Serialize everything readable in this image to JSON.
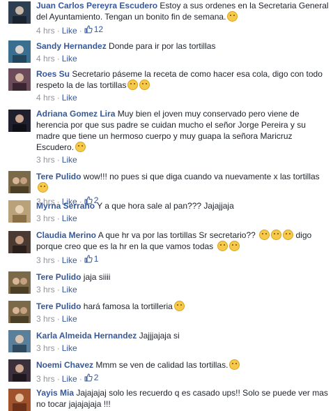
{
  "comments": [
    {
      "author": "Juan Carlos Pereyra Escudero",
      "text": " Estoy a sus ordenes en la Secretaria General del Ayuntamiento. Tengan un bonito fin de semana.",
      "time": "4 hrs",
      "like_label": "Like",
      "likes": "12",
      "emoji": [
        "smile-emoji"
      ],
      "avatar_color": "#2f3f52"
    },
    {
      "author": "Sandy Hernandez",
      "text": " Donde para ir por las tortillas",
      "time": "4 hrs",
      "like_label": "Like",
      "likes": "",
      "emoji": [],
      "avatar_color": "#3b6f8f"
    },
    {
      "author": "Roes Su",
      "text": " Secretario páseme la receta de como hacer esa cola, digo con todo respeto la de las tortillas",
      "time": "4 hrs",
      "like_label": "Like",
      "likes": "",
      "emoji": [
        "laugh-emoji",
        "laugh-emoji"
      ],
      "avatar_color": "#6b4a5a"
    },
    {
      "author": "Adriana Gomez Lira",
      "text": " Muy bien el joven muy conservado pero viene de herencia por que sus padre se cuidan mucho el señor Jorge Pereira y su madre que tiene un hermoso cuerpo y muy guapa la señora Maricruz Escudero.",
      "time": "3 hrs",
      "like_label": "Like",
      "likes": "",
      "emoji": [
        "smile-emoji"
      ],
      "avatar_color": "#1f1f2e"
    },
    {
      "author": "Tere Pulido",
      "text": " wow!!! no pues si que diga cuando va nuevamente x las tortillas",
      "time": "3 hrs",
      "like_label": "Like",
      "likes": "2",
      "emoji": [
        "smile-emoji"
      ],
      "avatar_color": "#7a6a4a"
    },
    {
      "author": "Myrna Serrano",
      "text": " Y a que hora sale al pan??? Jajajjaja",
      "time": "3 hrs",
      "like_label": "Like",
      "likes": "",
      "emoji": [],
      "avatar_color": "#b9a27a"
    },
    {
      "author": "Claudia Merino",
      "text": " A que hr va por las tortillas Sr secretario??",
      "text2": "digo porque creo que es la hr en la que vamos todas",
      "time": "3 hrs",
      "like_label": "Like",
      "likes": "1",
      "emoji": [
        "laugh-emoji",
        "laugh-emoji",
        "laugh-emoji"
      ],
      "emoji2": [
        "neutral-emoji",
        "neutral-emoji"
      ],
      "avatar_color": "#4a3a32"
    },
    {
      "author": "Tere Pulido",
      "text": " jaja siiii",
      "time": "3 hrs",
      "like_label": "Like",
      "likes": "",
      "emoji": [],
      "avatar_color": "#7a6a4a"
    },
    {
      "author": "Tere Pulido",
      "text": " hará famosa la tortilleria",
      "time": "3 hrs",
      "like_label": "Like",
      "likes": "",
      "emoji": [
        "smile-emoji"
      ],
      "avatar_color": "#7a6a4a"
    },
    {
      "author": "Karla Almeida Hernandez",
      "text": " Jajjjajaja si",
      "time": "3 hrs",
      "like_label": "Like",
      "likes": "",
      "emoji": [],
      "avatar_color": "#5a7f9a"
    },
    {
      "author": "Noemi Chavez",
      "text": " Mmm se ven de calidad las tortillas.",
      "time": "3 hrs",
      "like_label": "Like",
      "likes": "2",
      "emoji": [
        "wink-emoji"
      ],
      "avatar_color": "#3a2f3a"
    },
    {
      "author": "Yayis Mia",
      "text": " Jajajajaj solo les recuerdo q es casado ups!! Solo se puede ver mas no tocar jajajajaja !!!",
      "time": "",
      "like_label": "",
      "likes": "",
      "emoji": [],
      "avatar_color": "#a0522d"
    }
  ],
  "colors": {
    "author": "#365899",
    "meta": "#90949c",
    "text": "#1d2129",
    "emoji": "#f7c94b"
  }
}
